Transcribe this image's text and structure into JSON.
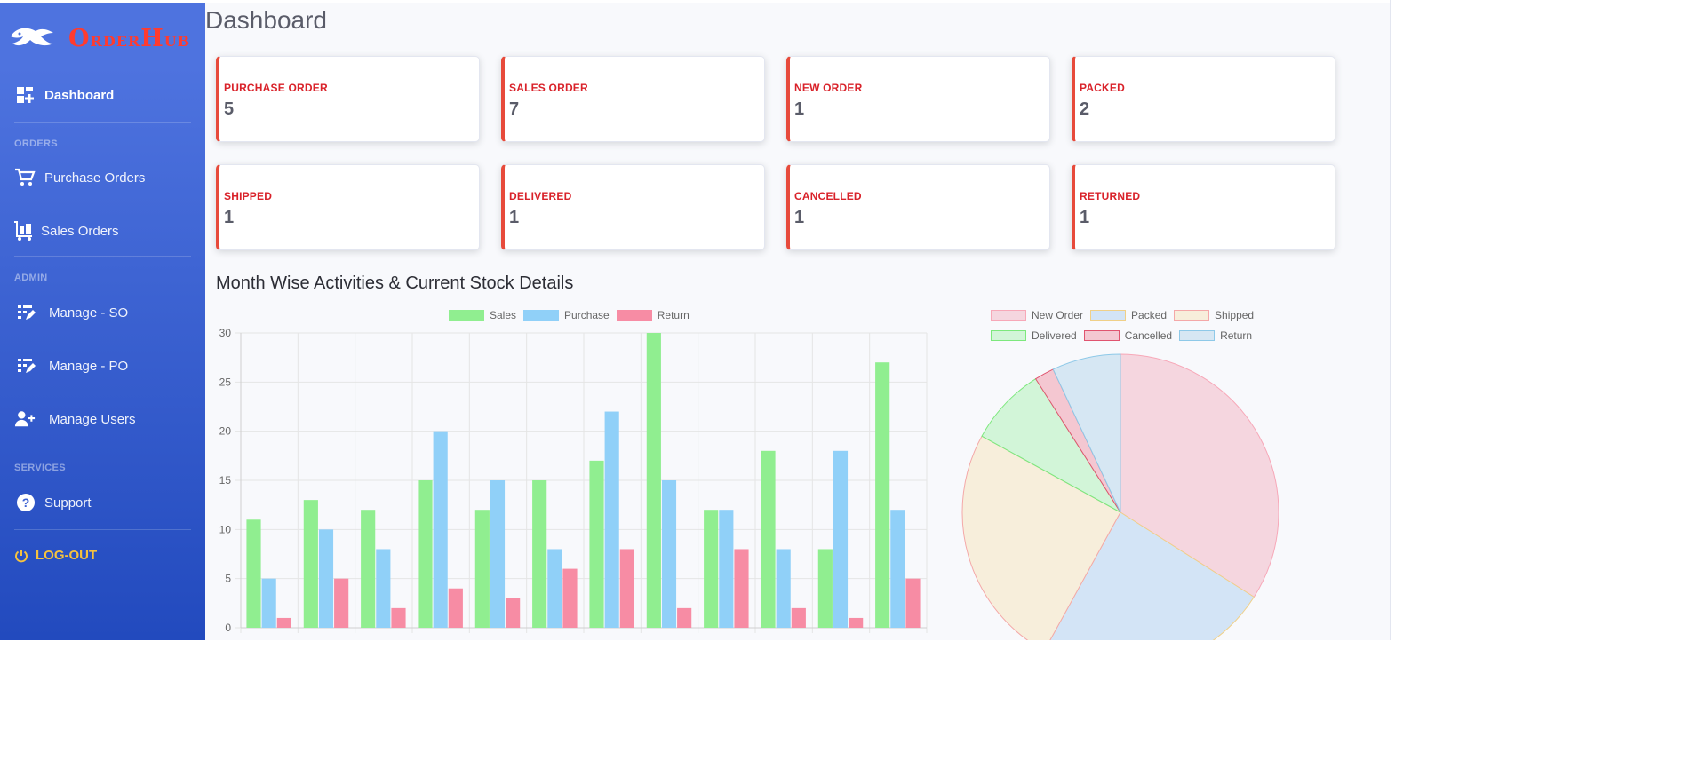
{
  "brand": {
    "name_first_big": "O",
    "name_first_small": "RDER",
    "name_second_big": "H",
    "name_second_small": "UB"
  },
  "sidebar": {
    "dashboard": "Dashboard",
    "heading_orders": "ORDERS",
    "purchase_orders": "Purchase Orders",
    "sales_orders": "Sales Orders",
    "heading_admin": "ADMIN",
    "manage_so": "Manage - SO",
    "manage_po": "Manage - PO",
    "manage_users": "Manage Users",
    "heading_services": "SERVICES",
    "support": "Support",
    "logout": "LOG-OUT"
  },
  "page": {
    "title": "Dashboard",
    "section_title": "Month Wise Activities & Current Stock Details"
  },
  "cards": [
    {
      "label": "PURCHASE ORDER",
      "value": "5"
    },
    {
      "label": "SALES ORDER",
      "value": "7"
    },
    {
      "label": "NEW ORDER",
      "value": "1"
    },
    {
      "label": "PACKED",
      "value": "2"
    },
    {
      "label": "SHIPPED",
      "value": "1"
    },
    {
      "label": "DELIVERED",
      "value": "1"
    },
    {
      "label": "CANCELLED",
      "value": "1"
    },
    {
      "label": "RETURNED",
      "value": "1"
    }
  ],
  "colors": {
    "accent": "#e74a3b",
    "sidebar_top": "#4e73df",
    "sidebar_bottom": "#224abe"
  },
  "chart_data": [
    {
      "type": "bar",
      "categories": [
        "",
        "",
        "",
        "",
        "",
        "",
        "",
        "",
        "",
        "",
        "",
        ""
      ],
      "series": [
        {
          "name": "Sales",
          "color": "#90ee90",
          "values": [
            11,
            13,
            12,
            15,
            12,
            15,
            17,
            30,
            12,
            18,
            8,
            27
          ]
        },
        {
          "name": "Purchase",
          "color": "#90d0f8",
          "values": [
            5,
            10,
            8,
            20,
            15,
            8,
            22,
            15,
            12,
            8,
            18,
            12
          ]
        },
        {
          "name": "Return",
          "color": "#f78ca4",
          "values": [
            1,
            5,
            2,
            4,
            3,
            6,
            8,
            2,
            8,
            2,
            1,
            5
          ]
        }
      ],
      "ylim": [
        0,
        30
      ],
      "yticks": [
        "0",
        "5",
        "10",
        "15",
        "20",
        "25",
        "30"
      ],
      "grid": true,
      "legend": "top"
    },
    {
      "type": "pie",
      "labels": [
        "New Order",
        "Packed",
        "Shipped",
        "Delivered",
        "Cancelled",
        "Return"
      ],
      "values": [
        34,
        24,
        25,
        8,
        2,
        7
      ],
      "fill_colors": [
        "#f5d6df",
        "#d3e4f6",
        "#f7eedb",
        "#d2f5d8",
        "#f4c7d1",
        "#d6e7f3"
      ],
      "border_colors": [
        "#f7a8b8",
        "#f0d088",
        "#f4a8a8",
        "#7de87d",
        "#e0546f",
        "#8ec9e8"
      ],
      "legend": "top"
    }
  ]
}
